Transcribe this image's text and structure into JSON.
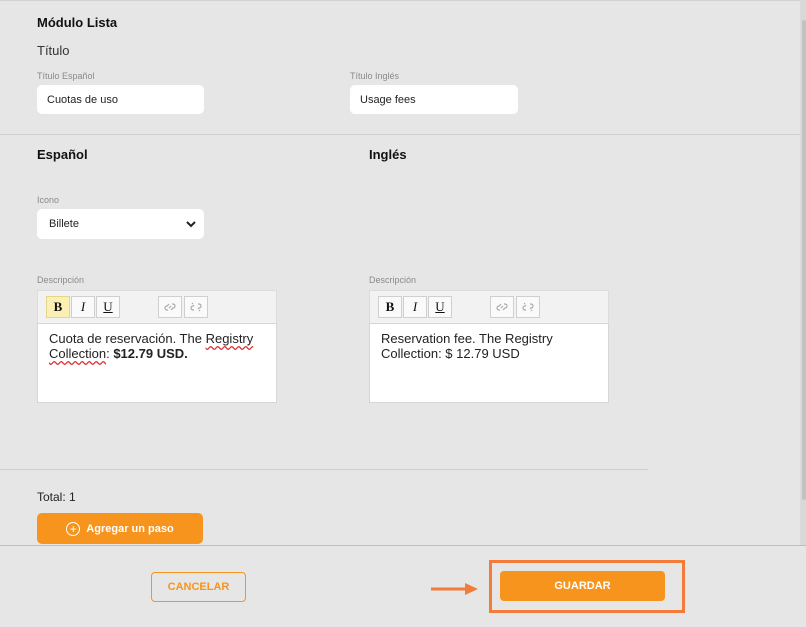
{
  "module": {
    "title": "Módulo Lista",
    "subtitle": "Título",
    "title_es_label": "Título Español",
    "title_es_value": "Cuotas de uso",
    "title_en_label": "Título Inglés",
    "title_en_value": "Usage fees"
  },
  "spanish": {
    "heading": "Español",
    "icon_label": "Icono",
    "icon_value": "Billete",
    "description_label": "Descripción",
    "description_part1": "Cuota de reservación. The ",
    "description_misspelled": "Registry Collection",
    "description_part2": ": ",
    "description_bold": "$12.79 USD."
  },
  "english": {
    "heading": "Inglés",
    "description_label": "Descripción",
    "description_text": "Reservation fee. The Registry Collection: $ 12.79 USD"
  },
  "toolbar": {
    "bold": "B",
    "italic": "I",
    "underline": "U",
    "link_icon": "link-icon",
    "unlink_icon": "unlink-icon"
  },
  "steps": {
    "total": "Total: 1",
    "add_step": "Agregar un paso"
  },
  "footer": {
    "cancel": "CANCELAR",
    "save": "GUARDAR"
  },
  "colors": {
    "accent": "#f7941d",
    "highlight": "#f37c3a",
    "bold_active": "#fbf0b4"
  }
}
